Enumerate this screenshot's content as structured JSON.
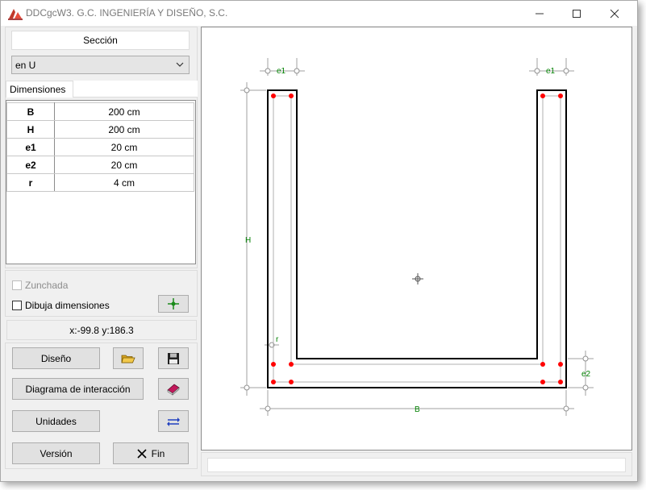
{
  "window": {
    "title": "DDCgcW3. G.C. INGENIERÍA Y DISEÑO, S.C."
  },
  "section": {
    "label": "Sección",
    "selected_type": "en U"
  },
  "tabs": [
    {
      "label": "Dimensiones"
    }
  ],
  "dimensions": [
    {
      "key": "B",
      "value": "200 cm"
    },
    {
      "key": "H",
      "value": "200 cm"
    },
    {
      "key": "e1",
      "value": "20 cm"
    },
    {
      "key": "e2",
      "value": "20 cm"
    },
    {
      "key": "r",
      "value": "4 cm"
    }
  ],
  "options": {
    "zunchada_label": "Zunchada",
    "zunchada_checked": false,
    "zunchada_enabled": false,
    "dibuja_label": "Dibuja dimensiones",
    "dibuja_checked": false
  },
  "cursor_readout": "x:-99.8 y:186.3",
  "buttons": {
    "diseno": "Diseño",
    "diagrama": "Diagrama de interacción",
    "unidades": "Unidades",
    "version": "Versión",
    "fin": "Fin"
  },
  "drawing": {
    "dim_labels": {
      "e1_left": "e1",
      "e1_right": "e1",
      "H": "H",
      "r": "r",
      "e2": "e2",
      "B": "B"
    },
    "dimension_color": "#008000",
    "rebar_color": "#ff0000",
    "outline_color": "#000000"
  },
  "icons": {
    "app": "ddc-logo-icon",
    "pick_point": "crosshair-green-icon",
    "open": "open-folder-icon",
    "save": "floppy-disk-icon",
    "book": "book-icon",
    "units": "arrows-swap-icon",
    "fin": "close-x-icon"
  }
}
